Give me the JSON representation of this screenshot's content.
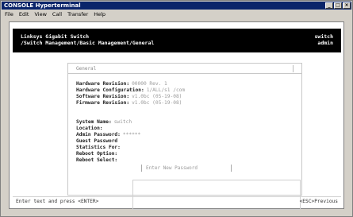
{
  "window": {
    "title": "CONSOLE Hyperterminal",
    "min_glyph": "_",
    "max_glyph": "□",
    "close_glyph": "×"
  },
  "menubar": {
    "items": [
      "File",
      "Edit",
      "View",
      "Call",
      "Transfer",
      "Help"
    ]
  },
  "header": {
    "left_line1": "Linksys Gigabit Switch",
    "left_line2": "/Switch Management/Basic Management/General",
    "right_line1": "switch",
    "right_line2": "admin"
  },
  "panel": {
    "title": "General",
    "fields": {
      "hardware_revision": {
        "label": "Hardware Revision:",
        "value": "00000 Rev. 1"
      },
      "hardware_config": {
        "label": "Hardware Configuration:",
        "value": "1/ALL/s1 /com"
      },
      "software_revision": {
        "label": "Software Revision:",
        "value": "v1.0bc (05-19-08)"
      },
      "firmware_revision": {
        "label": "Firmware Revision:",
        "value": "v1.0bc (05-19-08)"
      },
      "system_name": {
        "label": "System Name:",
        "value": "switch"
      },
      "location": {
        "label": "Location:",
        "value": ""
      },
      "admin_password": {
        "label": "Admin Password:",
        "value": "******"
      },
      "guest_password": {
        "label": "Guest Password",
        "value": ""
      },
      "statistics_for": {
        "label": "Statistics For:",
        "value": ""
      },
      "reboot_option": {
        "label": "Reboot Option:",
        "value": ""
      },
      "reboot_select": {
        "label": "Reboot Select:",
        "value": ""
      }
    },
    "input_placeholder": "Enter New Password"
  },
  "status": {
    "left": "Enter text and press <ENTER>",
    "right": "<ESC>Previous"
  },
  "colors": {
    "titlebar": "#0a246a",
    "header_bg": "#000000",
    "header_text": "#ffffff",
    "field_value": "#9a9a9a"
  }
}
